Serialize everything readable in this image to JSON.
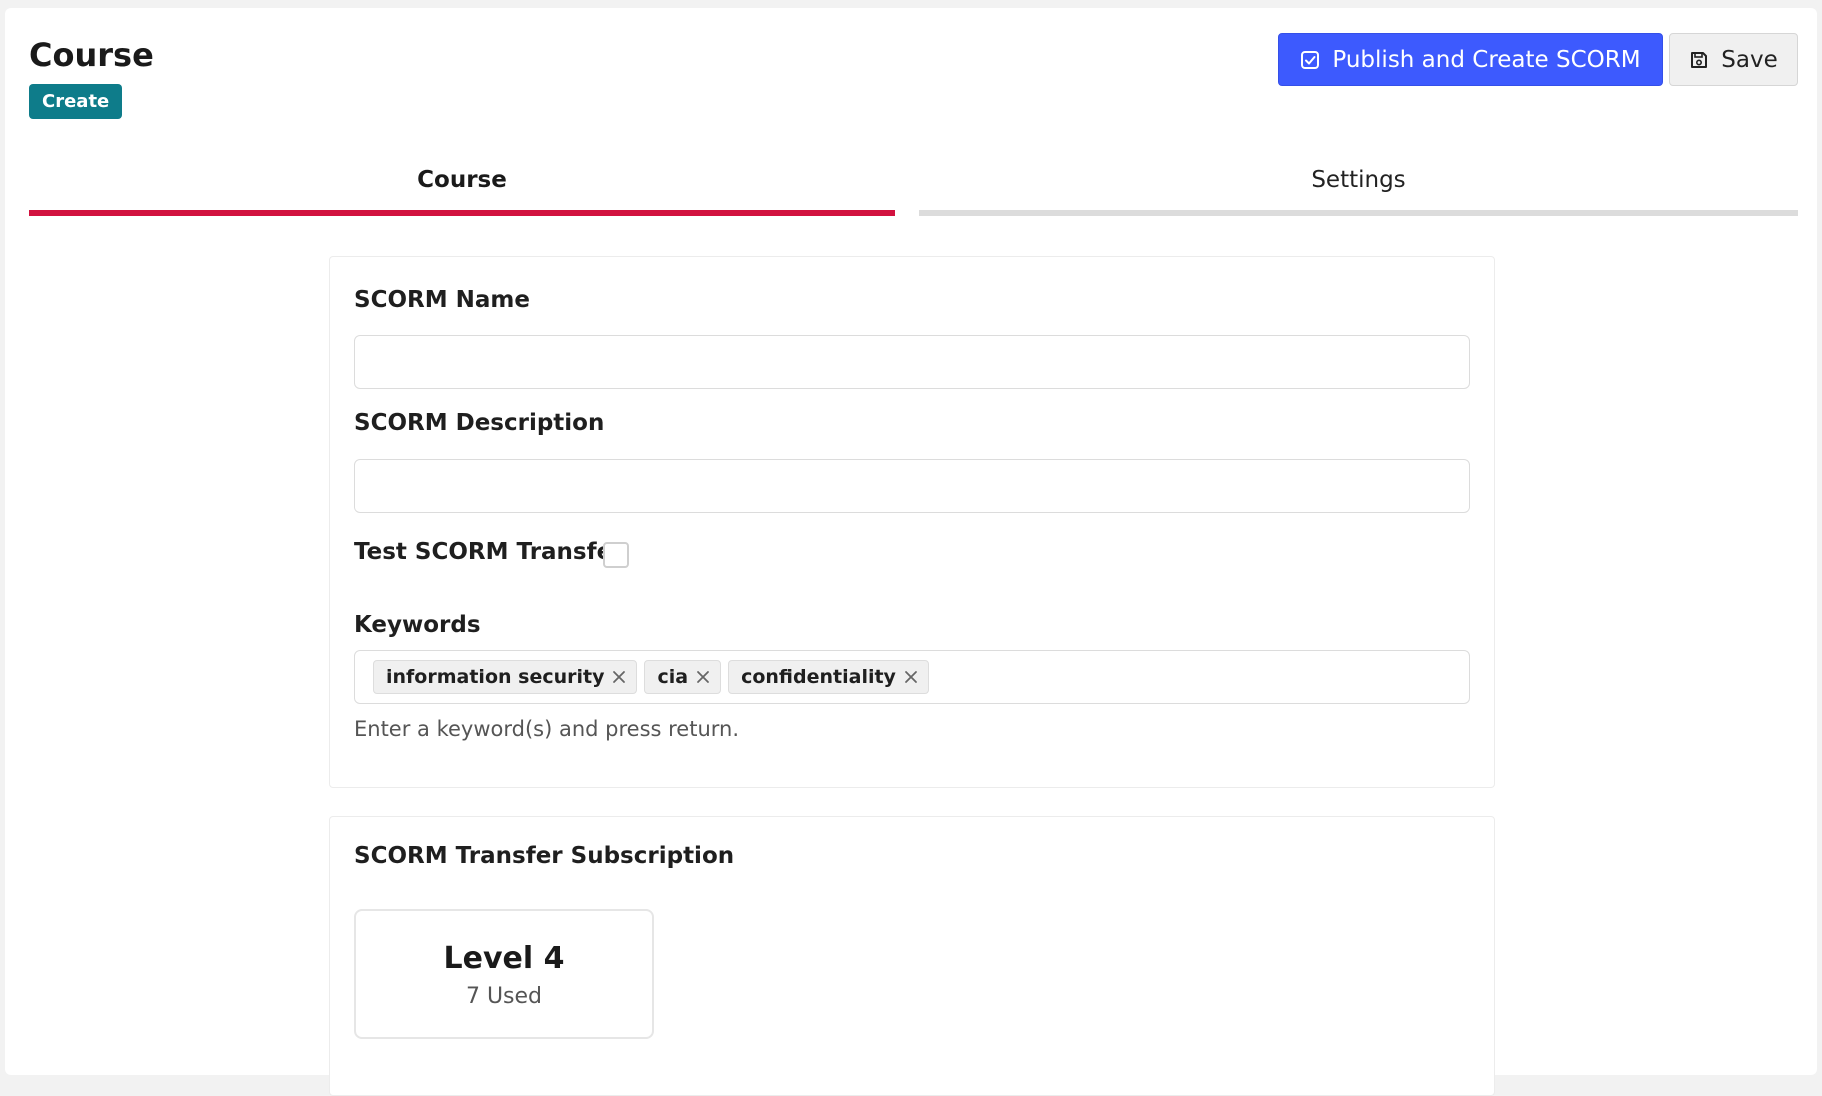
{
  "header": {
    "title": "Course",
    "badge": "Create",
    "publish_label": "Publish and Create SCORM",
    "save_label": "Save"
  },
  "tabs": [
    {
      "label": "Course",
      "active": true
    },
    {
      "label": "Settings",
      "active": false
    }
  ],
  "form": {
    "name_label": "SCORM Name",
    "name_value": "",
    "description_label": "SCORM Description",
    "description_value": "",
    "test_transfer_label": "Test SCORM Transfer",
    "test_transfer_checked": false,
    "keywords_label": "Keywords",
    "keywords": [
      "information security",
      "cia",
      "confidentiality"
    ],
    "keywords_help": "Enter a keyword(s) and press return."
  },
  "subscription": {
    "title": "SCORM Transfer Subscription",
    "level": "Level 4",
    "used": "7 Used"
  },
  "colors": {
    "primary": "#3d5afe",
    "badge": "#0e7c8a",
    "active_tab": "#d2123f"
  },
  "icons": {
    "publish": "checkbox-check-icon",
    "save": "floppy-disk-icon",
    "tag_remove": "close-icon"
  }
}
